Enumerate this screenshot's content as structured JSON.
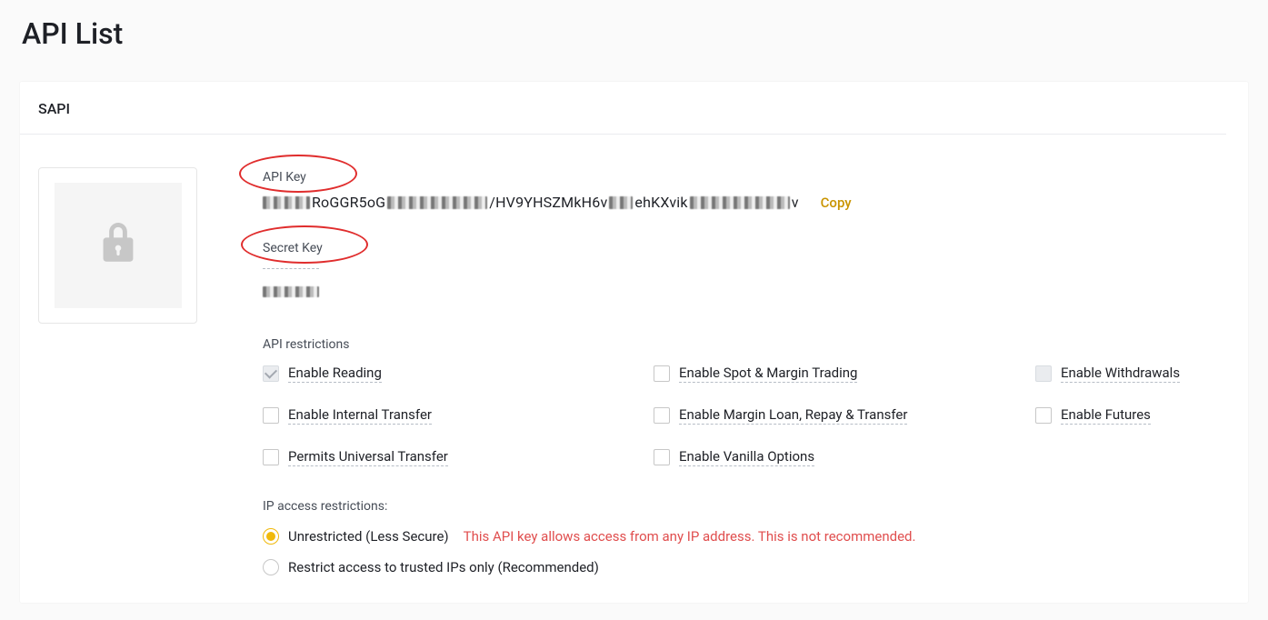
{
  "page": {
    "title": "API List"
  },
  "api": {
    "name": "SAPI",
    "apiKeyLabel": "API Key",
    "apiKeyFragments": {
      "seg1": "RoGGR5oG",
      "seg2": "/HV9YHSZMkH6v",
      "seg3": "ehKXvik",
      "seg4": "v"
    },
    "copyLabel": "Copy",
    "secretKeyLabel": "Secret Key",
    "restrictionsLabel": "API restrictions",
    "permissions": [
      {
        "label": "Enable Reading",
        "checked": true,
        "disabled": true
      },
      {
        "label": "Enable Spot & Margin Trading",
        "checked": false,
        "disabled": false
      },
      {
        "label": "Enable Withdrawals",
        "checked": false,
        "disabled": true
      },
      {
        "label": "Enable Internal Transfer",
        "checked": false,
        "disabled": false
      },
      {
        "label": "Enable Margin Loan, Repay & Transfer",
        "checked": false,
        "disabled": false
      },
      {
        "label": "Enable Futures",
        "checked": false,
        "disabled": false
      },
      {
        "label": "Permits Universal Transfer",
        "checked": false,
        "disabled": false
      },
      {
        "label": "Enable Vanilla Options",
        "checked": false,
        "disabled": false
      }
    ],
    "ipAccess": {
      "title": "IP access restrictions:",
      "options": {
        "unrestricted": {
          "label": "Unrestricted (Less Secure)",
          "warning": "This API key allows access from any IP address. This is not recommended.",
          "selected": true
        },
        "restricted": {
          "label": "Restrict access to trusted IPs only (Recommended)",
          "selected": false
        }
      }
    }
  }
}
